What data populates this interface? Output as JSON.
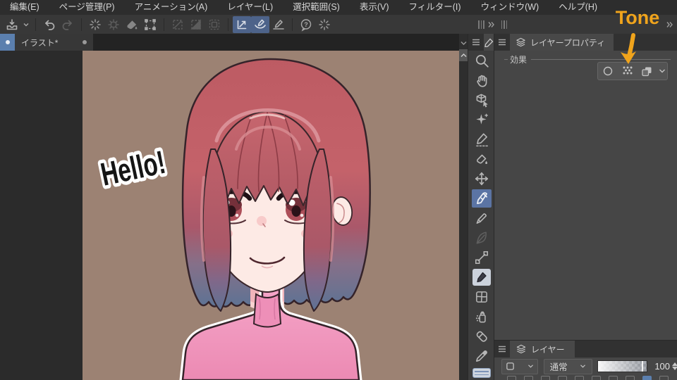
{
  "menu_bar": {
    "items": [
      "編集(E)",
      "ページ管理(P)",
      "アニメーション(A)",
      "レイヤー(L)",
      "選択範囲(S)",
      "表示(V)",
      "フィルター(I)",
      "ウィンドウ(W)",
      "ヘルプ(H)"
    ]
  },
  "command_bar": {
    "buttons": [
      "app-menu",
      "undo",
      "redo",
      "clear",
      "clear-outside-selection",
      "fill",
      "scale-rotate",
      "deselect",
      "invert-selection",
      "selection-border",
      "snap-to-ruler",
      "snap-to-special-ruler",
      "snap-to-grid",
      "ask-question",
      "update"
    ],
    "active_toggles": [
      "snap-to-ruler",
      "snap-to-special-ruler"
    ]
  },
  "document_tab": {
    "label": "イラスト*"
  },
  "tool_palette": {
    "selected_tool": "pen",
    "tools": [
      "zoom",
      "hand",
      "operation",
      "auto-select",
      "selection-pen",
      "fill-gradient",
      "move-layer",
      "pen",
      "marker",
      "pencil",
      "figure",
      "brush",
      "frame-border",
      "airbrush",
      "eraser",
      "eyedropper"
    ]
  },
  "layer_property_panel": {
    "tab_label": "レイヤープロパティ",
    "section_label": "効果",
    "effect_buttons": [
      "border-effect",
      "tone",
      "layer-color"
    ]
  },
  "annotation": {
    "label": "Tone",
    "color": "#f0a41c",
    "target": "tone-effect-button"
  },
  "layer_panel": {
    "tab_label": "レイヤー",
    "blend_mode": "通常",
    "opacity_value": "100"
  },
  "canvas": {
    "greeting": "Hello!",
    "background_color": "#9c8273",
    "subject": "anime girl with red bob hair and pink turtleneck"
  }
}
